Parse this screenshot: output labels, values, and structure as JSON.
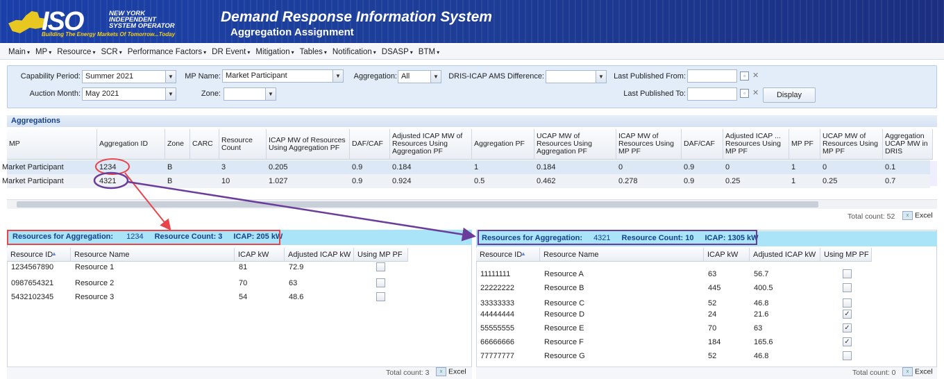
{
  "header": {
    "logo_word": "ISO",
    "logo_lines": [
      "NEW YORK",
      "INDEPENDENT",
      "SYSTEM OPERATOR"
    ],
    "logo_tagline": "Building The Energy Markets Of Tomorrow...Today",
    "title": "Demand Response Information System",
    "subtitle": "Aggregation Assignment"
  },
  "menu": [
    "Main",
    "MP",
    "Resource",
    "SCR",
    "Performance Factors",
    "DR Event",
    "Mitigation",
    "Tables",
    "Notification",
    "DSASP",
    "BTM"
  ],
  "filters": {
    "capability_period_label": "Capability Period:",
    "capability_period_value": "Summer 2021",
    "auction_month_label": "Auction Month:",
    "auction_month_value": "May 2021",
    "mp_name_label": "MP Name:",
    "mp_name_value": "Market Participant",
    "zone_label": "Zone:",
    "zone_value": "",
    "aggregation_label": "Aggregation:",
    "aggregation_value": "All",
    "dris_label": "DRIS-ICAP AMS Difference:",
    "dris_value": "",
    "last_pub_from_label": "Last Published From:",
    "last_pub_to_label": "Last Published To:",
    "display_label": "Display"
  },
  "aggregations": {
    "title": "Aggregations",
    "headers": [
      "MP",
      "Aggregation ID",
      "Zone",
      "CARC",
      "Resource Count",
      "ICAP MW of Resources Using Aggregation PF",
      "DAF/CAF",
      "Adjusted ICAP MW of Resources Using Aggregation PF",
      "Aggregation PF",
      "UCAP MW of Resources Using Aggregation PF",
      "ICAP MW of Resources Using MP PF",
      "DAF/CAF",
      "Adjusted ICAP ... Resources Using MP PF",
      "MP PF",
      "UCAP MW of Resources Using MP PF",
      "Aggregation UCAP MW in DRIS"
    ],
    "rows": [
      [
        "Market Participant",
        "1234",
        "B",
        "",
        "3",
        "0.205",
        "0.9",
        "0.184",
        "1",
        "0.184",
        "0",
        "0.9",
        "0",
        "1",
        "0",
        "0.1"
      ],
      [
        "Market Participant",
        "4321",
        "B",
        "",
        "10",
        "1.027",
        "0.9",
        "0.924",
        "0.5",
        "0.462",
        "0.278",
        "0.9",
        "0.25",
        "1",
        "0.25",
        "0.7"
      ]
    ],
    "total": "Total count: 52",
    "excel": "Excel"
  },
  "left_panel": {
    "agg_label": "Resources for Aggregation:",
    "agg_id": "1234",
    "count": "Resource Count: 3",
    "icap": "ICAP: 205 kW",
    "headers": [
      "Resource ID",
      "Resource Name",
      "ICAP kW",
      "Adjusted ICAP kW",
      "Using MP PF"
    ],
    "rows": [
      {
        "id": "1234567890",
        "name": "Resource 1",
        "icap": "81",
        "adj": "72.9",
        "mp": false
      },
      {
        "id": "0987654321",
        "name": "Resource 2",
        "icap": "70",
        "adj": "63",
        "mp": false
      },
      {
        "id": "5432102345",
        "name": "Resource 3",
        "icap": "54",
        "adj": "48.6",
        "mp": false
      }
    ],
    "total": "Total count: 3",
    "excel": "Excel"
  },
  "right_panel": {
    "agg_label": "Resources for Aggregation:",
    "agg_id": "4321",
    "count": "Resource Count: 10",
    "icap": "ICAP: 1305 kW",
    "headers": [
      "Resource ID",
      "Resource Name",
      "ICAP kW",
      "Adjusted ICAP kW",
      "Using MP PF"
    ],
    "rows": [
      {
        "id": "11111111",
        "name": "Resource A",
        "icap": "63",
        "adj": "56.7",
        "mp": false
      },
      {
        "id": "22222222",
        "name": "Resource B",
        "icap": "445",
        "adj": "400.5",
        "mp": false
      },
      {
        "id": "33333333",
        "name": "Resource C",
        "icap": "52",
        "adj": "46.8",
        "mp": false
      },
      {
        "id": "44444444",
        "name": "Resource D",
        "icap": "24",
        "adj": "21.6",
        "mp": true
      },
      {
        "id": "55555555",
        "name": "Resource E",
        "icap": "70",
        "adj": "63",
        "mp": true
      },
      {
        "id": "66666666",
        "name": "Resource F",
        "icap": "184",
        "adj": "165.6",
        "mp": true
      },
      {
        "id": "77777777",
        "name": "Resource G",
        "icap": "52",
        "adj": "46.8",
        "mp": false
      }
    ],
    "total": "Total count: 0",
    "excel": "Excel"
  },
  "colors": {
    "annot_red": "#e8454a",
    "annot_purple": "#6a3d9a",
    "header_blue": "#1c3f9e",
    "panel_head": "#a9e4f8"
  }
}
